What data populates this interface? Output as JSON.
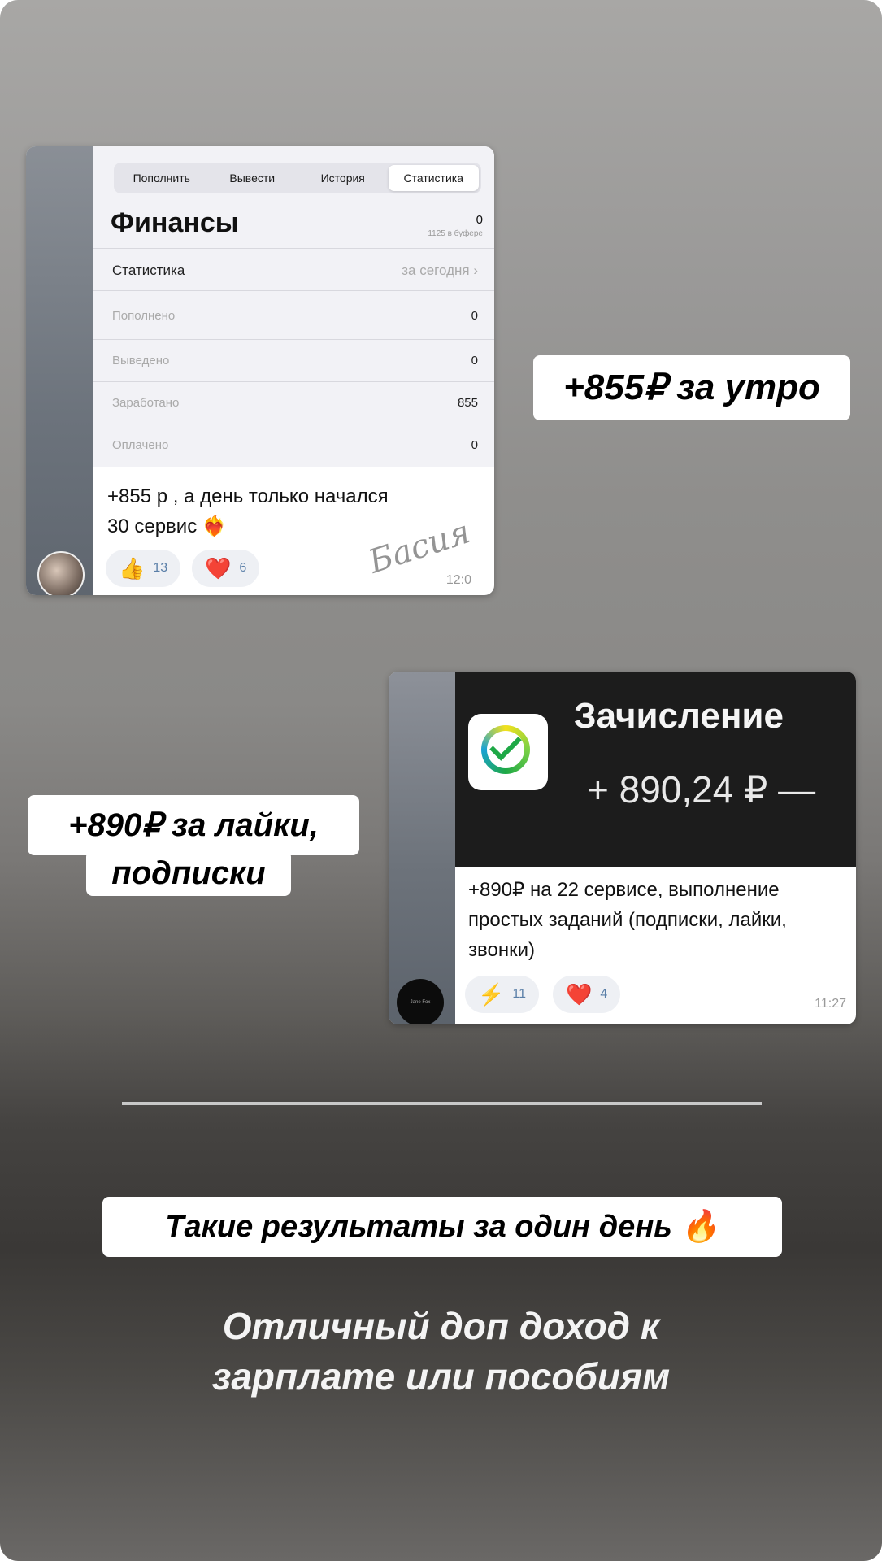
{
  "shot1": {
    "tabs": [
      "Пополнить",
      "Вывести",
      "История",
      "Статистика"
    ],
    "title": "Финансы",
    "balance": "0",
    "buffer": "1125 в буфере",
    "stats_header": {
      "label": "Статистика",
      "value": "за сегодня"
    },
    "rows": [
      {
        "label": "Пополнено",
        "value": "0"
      },
      {
        "label": "Выведено",
        "value": "0"
      },
      {
        "label": "Заработано",
        "value": "855"
      },
      {
        "label": "Оплачено",
        "value": "0"
      }
    ],
    "message_line1": "+855 р , а день только начался",
    "message_line2": "30 сервис",
    "heart_fire_emoji": "❤️‍🔥",
    "reactions": [
      {
        "emoji": "👍",
        "count": "13"
      },
      {
        "emoji": "❤️",
        "count": "6"
      }
    ],
    "time": "12:0",
    "signature": "Басия"
  },
  "caption1": "+855₽ за утро",
  "caption2_line1": "+890₽ за лайки,",
  "caption2_line2": "подписки",
  "shot2": {
    "banner_title": "Зачисление",
    "banner_amount": "+ 890,24 ₽ —",
    "avatar_text": "Jane Fox",
    "message": "+890₽ на 22 сервисе, выполнение простых заданий (подписки, лайки, звонки)",
    "reactions": [
      {
        "emoji": "⚡",
        "count": "11"
      },
      {
        "emoji": "❤️",
        "count": "4"
      }
    ],
    "time": "11:27"
  },
  "caption3": "Такие результаты за один день 🔥",
  "bottom_line1": "Отличный доп доход к",
  "bottom_line2": "зарплате или пособиям"
}
